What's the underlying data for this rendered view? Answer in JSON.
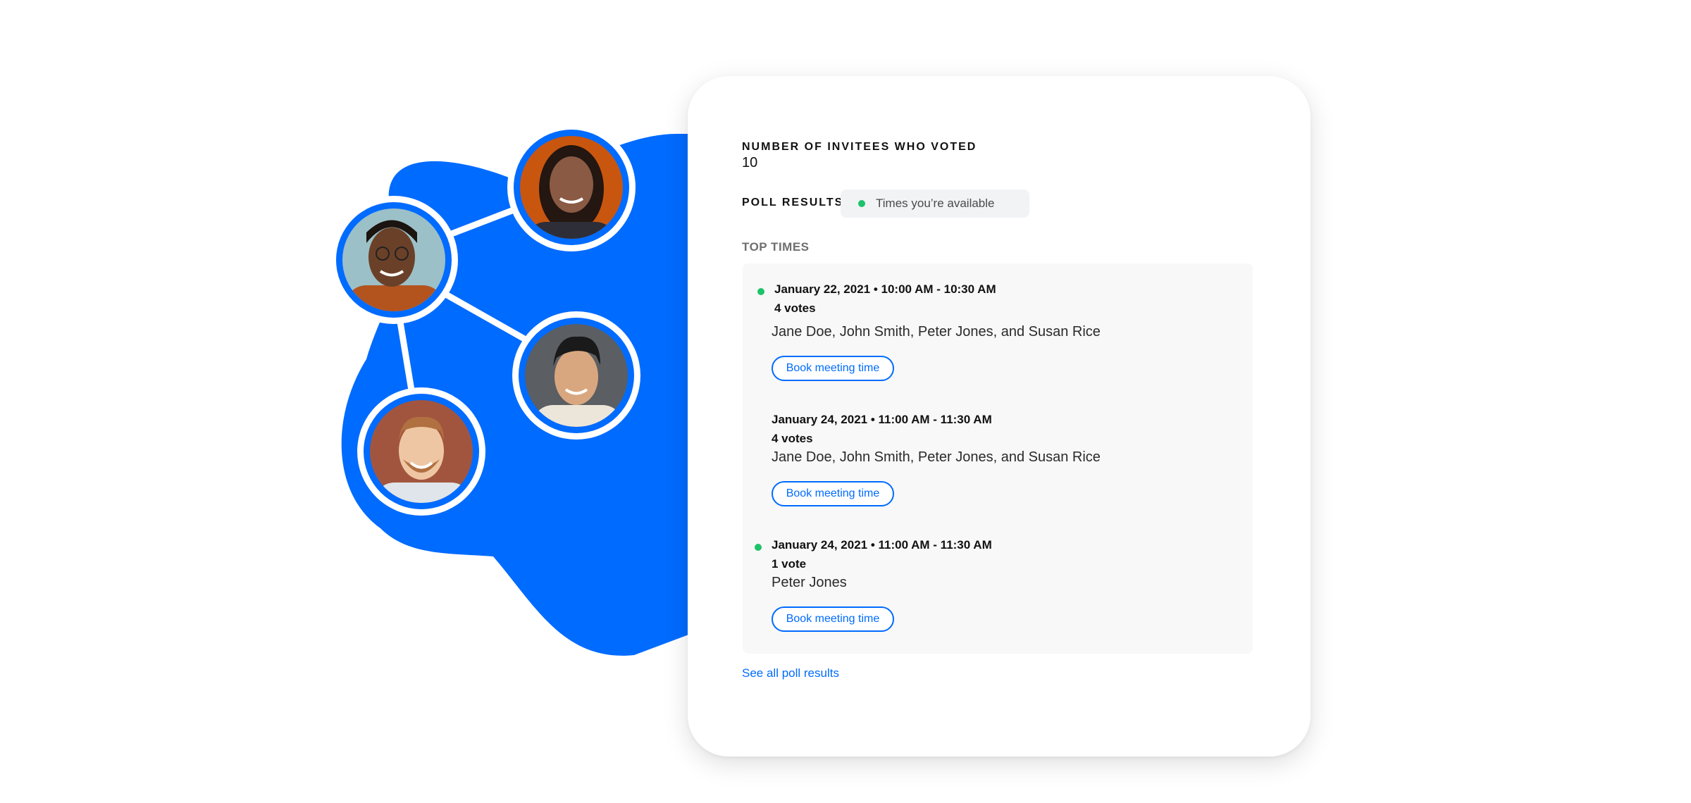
{
  "colors": {
    "brand_blue": "#006bff",
    "available_green": "#1ec26a",
    "panel_bg": "#f8f8f8"
  },
  "illustration": {
    "people": [
      {
        "name": "person-avatar-top",
        "skin": "#8a5a44",
        "bg": "#c9560f",
        "hair": "#241611",
        "shirt": "#2e2e38"
      },
      {
        "name": "person-avatar-left",
        "skin": "#6a4128",
        "bg": "#9cc0c8",
        "hair": "#1b1410",
        "shirt": "#b3541e"
      },
      {
        "name": "person-avatar-right",
        "skin": "#d9a77f",
        "bg": "#5b5e62",
        "hair": "#1a1a1a",
        "shirt": "#ece6da"
      },
      {
        "name": "person-avatar-bottom",
        "skin": "#efc6a3",
        "bg": "#a2553e",
        "hair": "#b07040",
        "shirt": "#dfe5ea"
      }
    ]
  },
  "card": {
    "invitees_label": "NUMBER OF INVITEES WHO VOTED",
    "invitees_value": "10",
    "poll_label": "POLL RESULTS",
    "legend_text": "Times you’re available",
    "top_times_label": "TOP TIMES",
    "slots": [
      {
        "time": "January 22, 2021 • 10:00 AM - 10:30 AM",
        "votes": "4 votes",
        "voters": "Jane Doe, John Smith, Peter Jones, and Susan Rice",
        "button": "Book meeting time",
        "available": true
      },
      {
        "time": "January 24, 2021 • 11:00 AM - 11:30 AM",
        "votes": "4 votes",
        "voters": "Jane Doe, John Smith, Peter Jones, and Susan Rice",
        "button": "Book meeting time",
        "available": false
      },
      {
        "time": "January 24, 2021 • 11:00 AM - 11:30 AM",
        "votes": "1 vote",
        "voters": "Peter Jones",
        "button": "Book meeting time",
        "available": true
      }
    ],
    "see_all": "See all poll results"
  }
}
